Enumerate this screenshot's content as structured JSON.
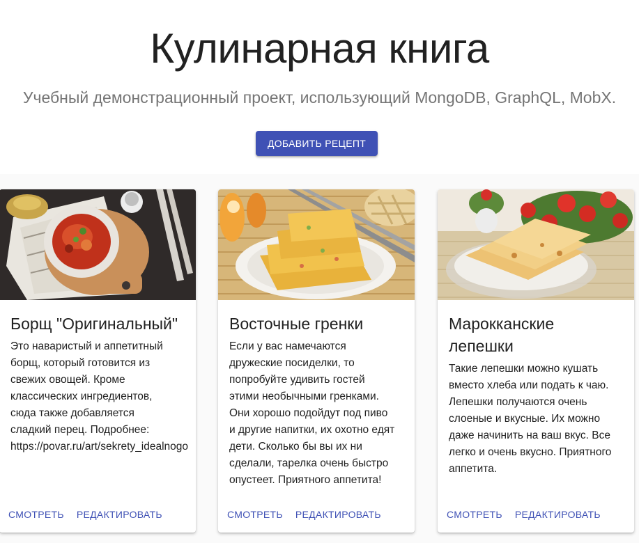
{
  "header": {
    "title": "Кулинарная книга",
    "subtitle": "Учебный демонстрационный проект, использующий MongoDB, GraphQL, MobX.",
    "add_button_label": "ДОБАВИТЬ РЕЦЕПТ"
  },
  "theme": {
    "primary": "#3f51b5",
    "text": "#212121",
    "secondary_text": "#757575",
    "background": "#fafafa"
  },
  "recipes": [
    {
      "title": "Борщ \"Оригинальный\"",
      "description": "Это наваристый и аппетитный\nборщ, который готовится из\nсвежих овощей. Кроме\nклассических ингредиентов,\nсюда также добавляется\nсладкий перец. Подробнее:\nhttps://povar.ru/art/sekrety_idealnogo",
      "image": "borscht-photo",
      "view_label": "СМОТРЕТЬ",
      "edit_label": "РЕДАКТИРОВАТЬ"
    },
    {
      "title": "Восточные гренки",
      "description": "Если у вас намечаются\nдружеские посиделки, то\nпопробуйте удивить гостей\nэтими необычными гренками.\nОни хорошо подойдут под пиво\nи другие напитки, их охотно едят\nдети. Сколько бы вы их ни\nсделали, тарелка очень быстро\nопустеет. Приятного аппетита!",
      "image": "oriental-toasts-photo",
      "view_label": "СМОТРЕТЬ",
      "edit_label": "РЕДАКТИРОВАТЬ"
    },
    {
      "title": "Марокканские\nлепешки",
      "description": "Такие лепешки можно кушать\nвместо хлеба или подать к чаю.\nЛепешки получаются очень\nслоеные и вкусные. Их можно\nдаже начинить на ваш вкус. Все\nлегко и очень вкусно. Приятного\nаппетита.",
      "image": "moroccan-flatbread-photo",
      "view_label": "СМОТРЕТЬ",
      "edit_label": "РЕДАКТИРОВАТЬ"
    }
  ]
}
